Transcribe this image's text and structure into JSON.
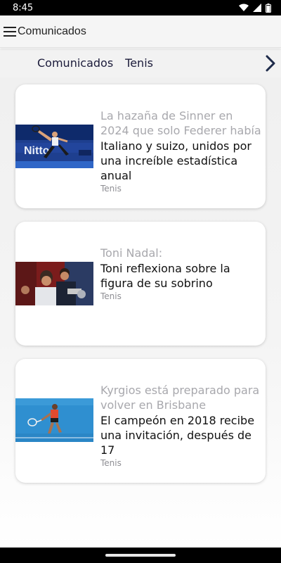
{
  "status_bar": {
    "time": "8:45",
    "icons": [
      "wifi-icon",
      "cell-signal-icon",
      "battery-icon"
    ]
  },
  "app_bar": {
    "title": "Comunicados",
    "menu_icon": "hamburger-menu-icon"
  },
  "tabs": {
    "items": [
      {
        "label": "Comunicados"
      },
      {
        "label": "Tenis"
      }
    ],
    "next_icon": "chevron-right-icon"
  },
  "articles": [
    {
      "headline": "La hazaña de Sinner en 2024 que solo Federer había",
      "subtitle": "Italiano y suizo, unidos por una increíble estadística anual",
      "category": "Tenis",
      "thumbnail": "tennis-player-serve-photo"
    },
    {
      "headline": "Toni Nadal:",
      "subtitle": "Toni reflexiona sobre la figura de su sobrino",
      "category": "Tenis",
      "thumbnail": "tennis-celebration-photo"
    },
    {
      "headline": "Kyrgios está preparado para volver en Brisbane",
      "subtitle": "El campeón en 2018 recibe una invitación, después de 17",
      "category": "Tenis",
      "thumbnail": "tennis-player-hardcourt-photo"
    }
  ],
  "colors": {
    "headline": "#a8a8ad",
    "subtitle": "#111111",
    "category": "#8f8f94",
    "tab_text": "#1b1b3a",
    "chevron": "#1e2b4a"
  }
}
